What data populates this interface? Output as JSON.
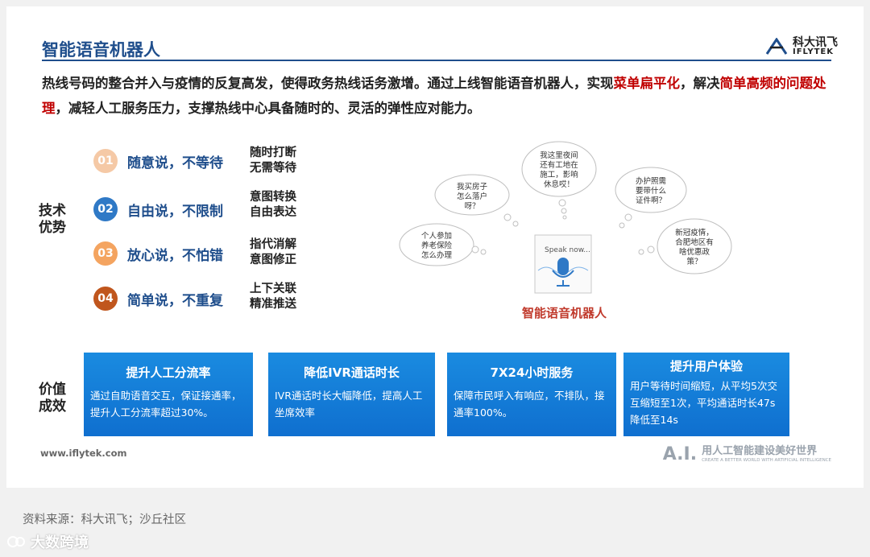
{
  "header": {
    "title": "智能语音机器人",
    "logo_cn": "科大讯飞",
    "logo_en": "IFLYTEK"
  },
  "intro": {
    "part1": "热线号码的整合并入与疫情的反复高发，使得政务热线话务激增。通过上线智能语音机器人，实现",
    "highlight1": "菜单扁平化",
    "part2": "，解决",
    "highlight2": "简单高频的问题处理",
    "part3": "，减轻人工服务压力，支撑热线中心具备随时的、灵活的弹性应对能力。"
  },
  "tech": {
    "label_line1": "技术",
    "label_line2": "优势",
    "items": [
      {
        "num": "01",
        "text": "随意说，不等待",
        "desc1": "随时打断",
        "desc2": "无需等待",
        "color": "#f5c9a6"
      },
      {
        "num": "02",
        "text": "自由说，不限制",
        "desc1": "意图转换",
        "desc2": "自由表达",
        "color": "#2f79c6"
      },
      {
        "num": "03",
        "text": "放心说，不怕错",
        "desc1": "指代消解",
        "desc2": "意图修正",
        "color": "#f4a460"
      },
      {
        "num": "04",
        "text": "简单说，不重复",
        "desc1": "上下关联",
        "desc2": "精准推送",
        "color": "#c0561d"
      }
    ]
  },
  "robot": {
    "title": "智能语音机器人",
    "speak": "Speak now...",
    "bubbles": [
      {
        "l1": "我买房子",
        "l2": "怎么落户",
        "l3": "呀？",
        "l4": ""
      },
      {
        "l1": "我这里夜间",
        "l2": "还有工地在",
        "l3": "施工，影响",
        "l4": "休息哎！"
      },
      {
        "l1": "办护照需",
        "l2": "要带什么",
        "l3": "证件啊？",
        "l4": ""
      },
      {
        "l1": "个人参加",
        "l2": "养老保险",
        "l3": "怎么办理",
        "l4": ""
      },
      {
        "l1": "新冠疫情，",
        "l2": "合肥地区有",
        "l3": "啥优惠政",
        "l4": "策？"
      }
    ]
  },
  "value": {
    "label_line1": "价值",
    "label_line2": "成效",
    "cards": [
      {
        "title": "提升人工分流率",
        "body": "通过自助语音交互，保证接通率，提升人工分流率超过30%。"
      },
      {
        "title": "降低IVR通话时长",
        "body": "IVR通话时长大幅降低，提高人工坐席效率"
      },
      {
        "title": "7X24小时服务",
        "body": "保障市民呼入有响应，不排队，接通率100%。"
      },
      {
        "title": "提升用户体验",
        "body": "用户等待时间缩短，从平均5次交互缩短至1次，平均通话时长47s降低至14s"
      }
    ]
  },
  "footer": {
    "url": "www.iflytek.com",
    "ai_mark": "A.I.",
    "ai_cn": "用人工智能建设美好世界",
    "ai_en": "CREATE A BETTER WORLD WITH ARTIFICIAL INTELLIGENCE"
  },
  "source": "资料来源：科大讯飞；沙丘社区",
  "watermark": "大数跨境",
  "colors": {
    "brand_blue": "#1f4e8c",
    "highlight_red": "#c00000",
    "card_blue": "#1a8be0"
  }
}
